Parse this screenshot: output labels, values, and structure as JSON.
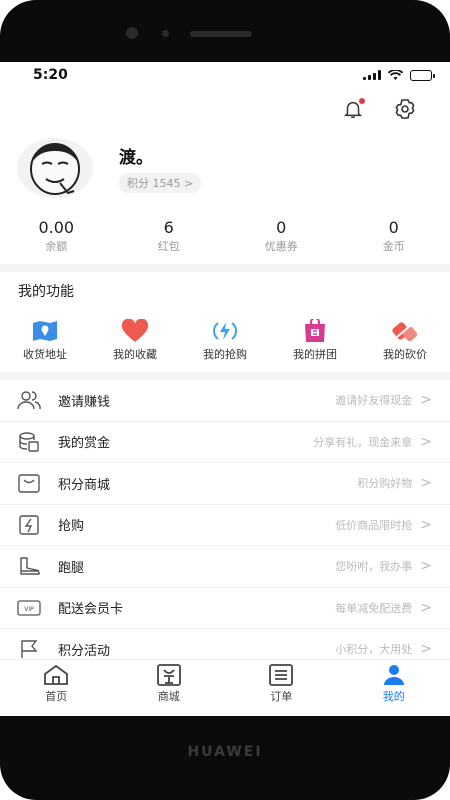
{
  "device": {
    "brand": "HUAWEI"
  },
  "status_bar": {
    "time": "5:20"
  },
  "profile": {
    "name": "渡。",
    "points_label": "积分 1545 >"
  },
  "stats": [
    {
      "value": "0.00",
      "label": "余额"
    },
    {
      "value": "6",
      "label": "红包"
    },
    {
      "value": "0",
      "label": "优惠券"
    },
    {
      "value": "0",
      "label": "金币"
    }
  ],
  "functions": {
    "title": "我的功能",
    "items": [
      {
        "label": "收货地址",
        "icon": "map-icon",
        "color": "#3a8ee6"
      },
      {
        "label": "我的收藏",
        "icon": "heart-icon",
        "color": "#ef5a4f"
      },
      {
        "label": "我的抢购",
        "icon": "flash-icon",
        "color": "#3aa0f0"
      },
      {
        "label": "我的拼团",
        "icon": "group-bag-icon",
        "color": "#d63b8e"
      },
      {
        "label": "我的砍价",
        "icon": "bargain-icon",
        "color": "#ef5a4f"
      }
    ]
  },
  "menu": [
    {
      "label": "邀请赚钱",
      "hint": "邀请好友得现金",
      "icon": "users-icon"
    },
    {
      "label": "我的赏金",
      "hint": "分享有礼，现金来拿",
      "icon": "coins-icon"
    },
    {
      "label": "积分商城",
      "hint": "积分购好物",
      "icon": "mall-icon"
    },
    {
      "label": "抢购",
      "hint": "低价商品限时抢",
      "icon": "flash-box-icon"
    },
    {
      "label": "跑腿",
      "hint": "您吩咐，我办事",
      "icon": "boot-icon"
    },
    {
      "label": "配送会员卡",
      "hint": "每单减免配送费",
      "icon": "vip-card-icon"
    },
    {
      "label": "积分活动",
      "hint": "小积分，大用处",
      "icon": "flag-icon"
    }
  ],
  "tabs": [
    {
      "label": "首页",
      "icon": "home-icon"
    },
    {
      "label": "商城",
      "icon": "shop-icon"
    },
    {
      "label": "订单",
      "icon": "order-icon"
    },
    {
      "label": "我的",
      "icon": "user-icon",
      "active": true
    }
  ],
  "colors": {
    "accent": "#1a7cf0",
    "badge": "#e23b3b"
  }
}
